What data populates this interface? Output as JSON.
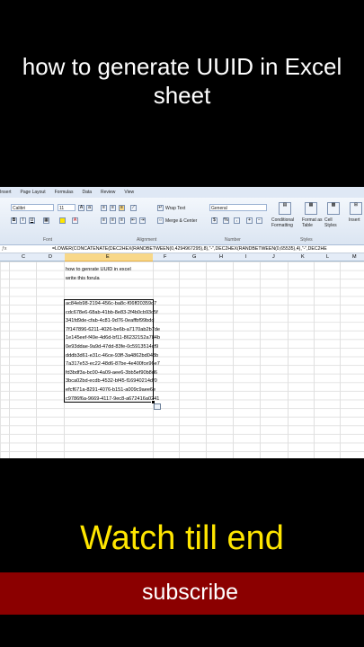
{
  "video": {
    "title": "how to generate UUID in Excel sheet",
    "cta": "Watch till end",
    "subscribe": "subscribe",
    "colors": {
      "cta": "#ffe600",
      "subscribe_bar": "#8b0000"
    }
  },
  "ribbon": {
    "tabs": [
      "Insert",
      "Page Layout",
      "Formulas",
      "Data",
      "Review",
      "View"
    ],
    "font_name": "Calibri",
    "font_size": "11",
    "wrap_text": "Wrap Text",
    "merge_center": "Merge & Center",
    "number_format": "General",
    "groups": [
      "Font",
      "Alignment",
      "Number",
      "Styles"
    ],
    "conditional_formatting": "Conditional Formatting",
    "format_as_table": "Format as Table",
    "cell_styles": "Cell Styles",
    "insert": "Insert"
  },
  "formula_bar": {
    "formula": "=LOWER(CONCATENATE(DEC2HEX(RANDBETWEEN(0,4294967295),8),\"-\",DEC2HEX(RANDBETWEEN(0,65535),4),\"-\",DEC2HE"
  },
  "columns": [
    "C",
    "D",
    "E",
    "F",
    "G",
    "H",
    "I",
    "J",
    "K",
    "L",
    "M"
  ],
  "sheet": {
    "note_line1": "how to genrate UUID in excel",
    "note_line2": "write this forula",
    "uuids": [
      "ac84eb98-2194-456c-ba8c-f06ff20359d7",
      "cdc678e6-68ab-41bb-8e83-2f4b0cb93c5f",
      "341fd9de-cfab-4c81-9d76-0eaffbf99bdd",
      "7f147896-6211-4026-be6b-a7170ab2b7de",
      "1e145eef-f49e-4d6d-bf11-86232152a784b",
      "0e93ddae-9a9d-47dd-83fe-0c5913514cf9",
      "dddb3d61-e31c-46ce-93ff-3a4862bd043b",
      "7a317e53-ec22-48d6-87be-4e400fce96e7",
      "fd3bdf3a-bc00-4a09-aee6-3bb5ef90b8d6",
      "3bca02bd-ecdb-4532-bf45-f16940214df0",
      "efcf671a-8291-4076-b151-a009c9aee6e",
      "c9786f6a-9669-4117-9ec8-a672416a0241"
    ]
  }
}
